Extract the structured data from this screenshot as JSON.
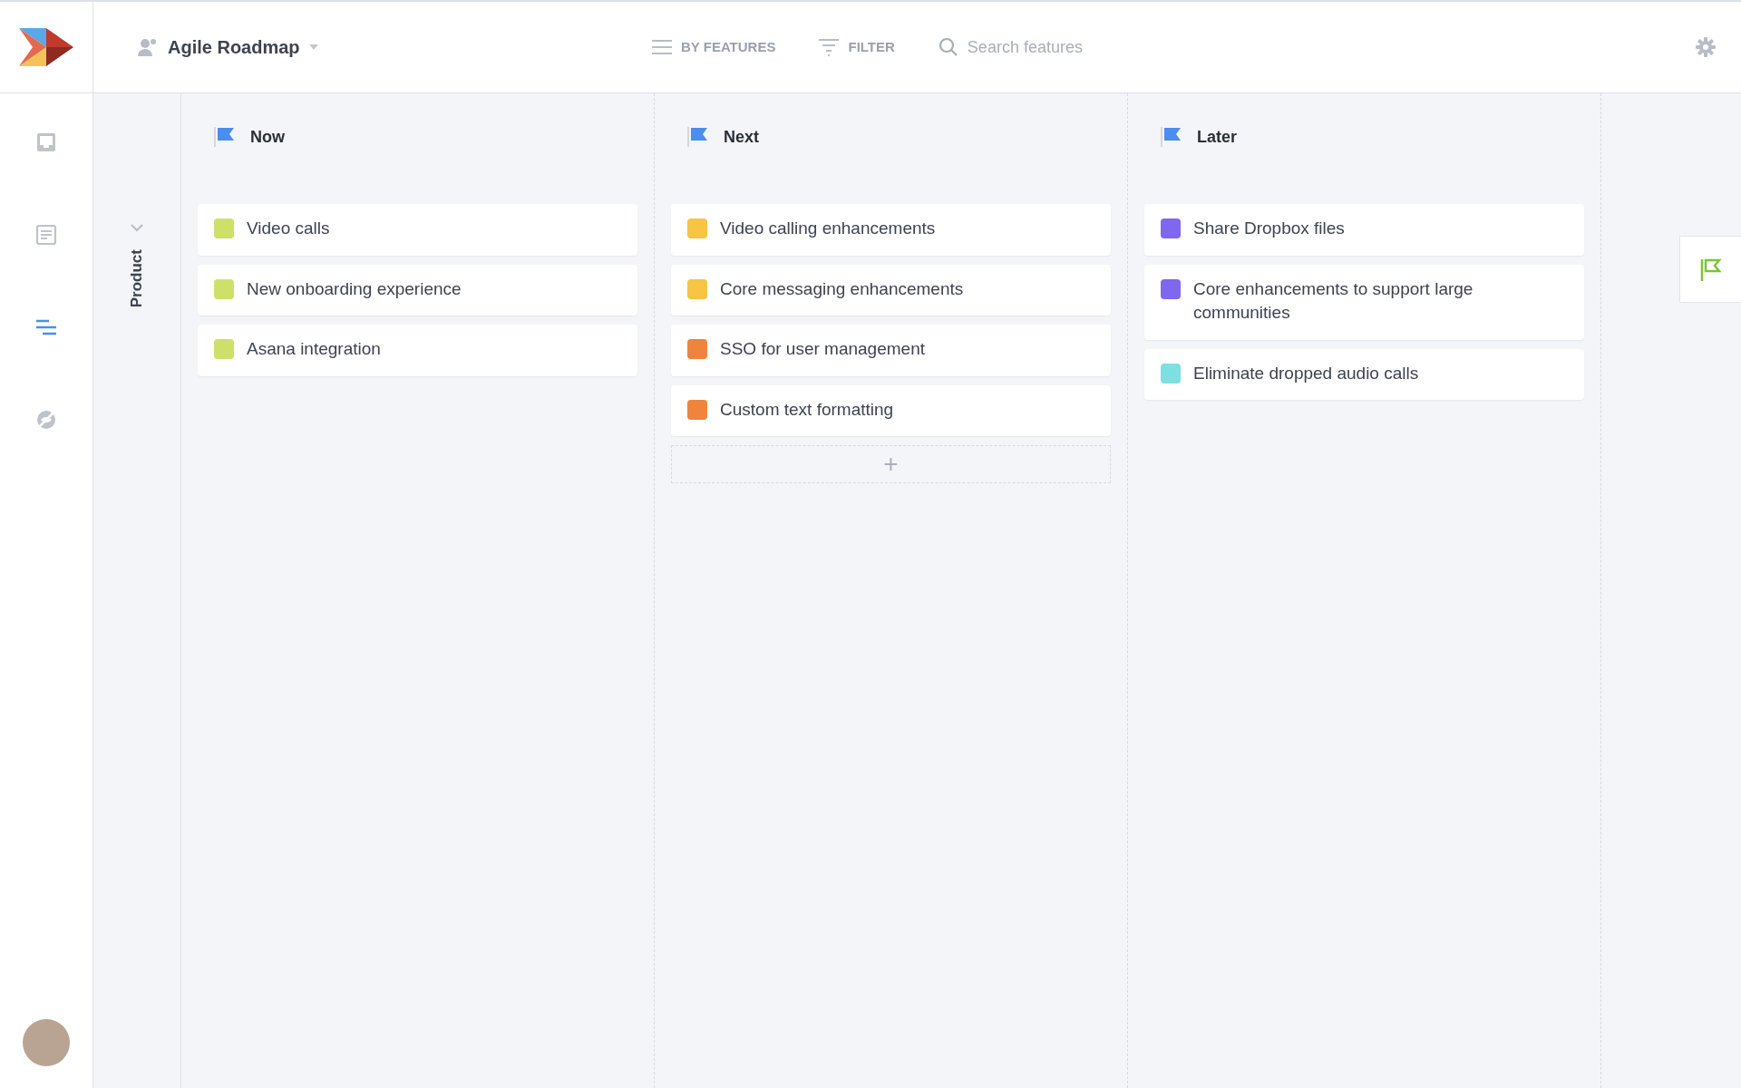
{
  "header": {
    "roadmap_title": "Agile Roadmap",
    "view_button": "BY FEATURES",
    "filter_button": "FILTER",
    "search": {
      "placeholder": "Search features"
    }
  },
  "sidebar": {
    "items": [
      {
        "kind": "inbox",
        "selected": false
      },
      {
        "kind": "document",
        "selected": false
      },
      {
        "kind": "roadmap",
        "selected": true
      },
      {
        "kind": "hidden",
        "selected": false
      }
    ]
  },
  "lane": {
    "label": "Product",
    "expanded": true
  },
  "columns": [
    {
      "title": "Now",
      "cards": [
        {
          "title": "Video calls",
          "color": "#cfe06a"
        },
        {
          "title": "New onboarding experience",
          "color": "#cfe06a"
        },
        {
          "title": "Asana integration",
          "color": "#cfe06a"
        }
      ]
    },
    {
      "title": "Next",
      "add_label": "+",
      "cards": [
        {
          "title": "Video calling enhancements",
          "color": "#f7c443"
        },
        {
          "title": "Core messaging enhancements",
          "color": "#f7c443"
        },
        {
          "title": "SSO for user management",
          "color": "#f0843c"
        },
        {
          "title": "Custom text formatting",
          "color": "#f0843c"
        }
      ]
    },
    {
      "title": "Later",
      "cards": [
        {
          "title": "Share Dropbox files",
          "color": "#8067f0"
        },
        {
          "title": "Core enhancements to support large communities",
          "color": "#8067f0"
        },
        {
          "title": "Eliminate dropped audio calls",
          "color": "#7ddfe0"
        }
      ]
    }
  ]
}
